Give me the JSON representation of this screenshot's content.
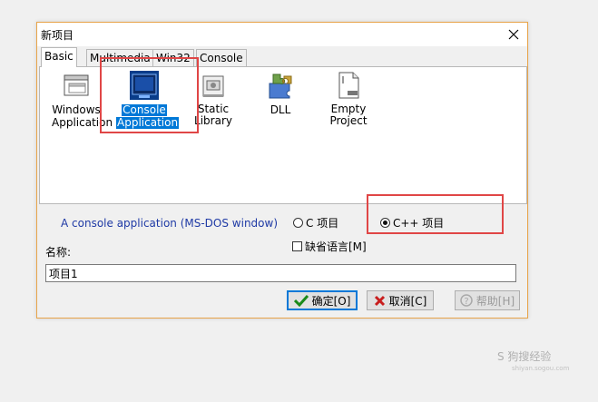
{
  "window": {
    "title": "新项目"
  },
  "tabs": [
    {
      "label": "Basic"
    },
    {
      "label": "Multimedia"
    },
    {
      "label": "Win32"
    },
    {
      "label": "Console"
    }
  ],
  "templates": [
    {
      "label_line1": "Windows",
      "label_line2": "Application",
      "icon": "windows-app-icon"
    },
    {
      "label_line1": "Console",
      "label_line2": "Application",
      "icon": "console-app-icon",
      "selected": true
    },
    {
      "label_line1": "Static Library",
      "label_line2": "",
      "icon": "static-library-icon"
    },
    {
      "label_line1": "DLL",
      "label_line2": "",
      "icon": "dll-icon"
    },
    {
      "label_line1": "Empty Project",
      "label_line2": "",
      "icon": "empty-project-icon"
    }
  ],
  "description": "A console application (MS-DOS window)",
  "language": {
    "c_label": "C 项目",
    "cpp_label": "C++ 项目",
    "selected": "cpp"
  },
  "default_language_label": "缺省语言[M]",
  "name": {
    "label": "名称:",
    "value": "项目1"
  },
  "buttons": {
    "ok": "确定[O]",
    "cancel": "取消[C]",
    "help": "帮助[H]"
  },
  "watermark": {
    "text": "S 狗搜经验",
    "sub": "shiyan.sogou.com"
  },
  "colors": {
    "highlight": "#0078d7",
    "annotation": "#e04646",
    "description_text": "#1f3aa5"
  }
}
